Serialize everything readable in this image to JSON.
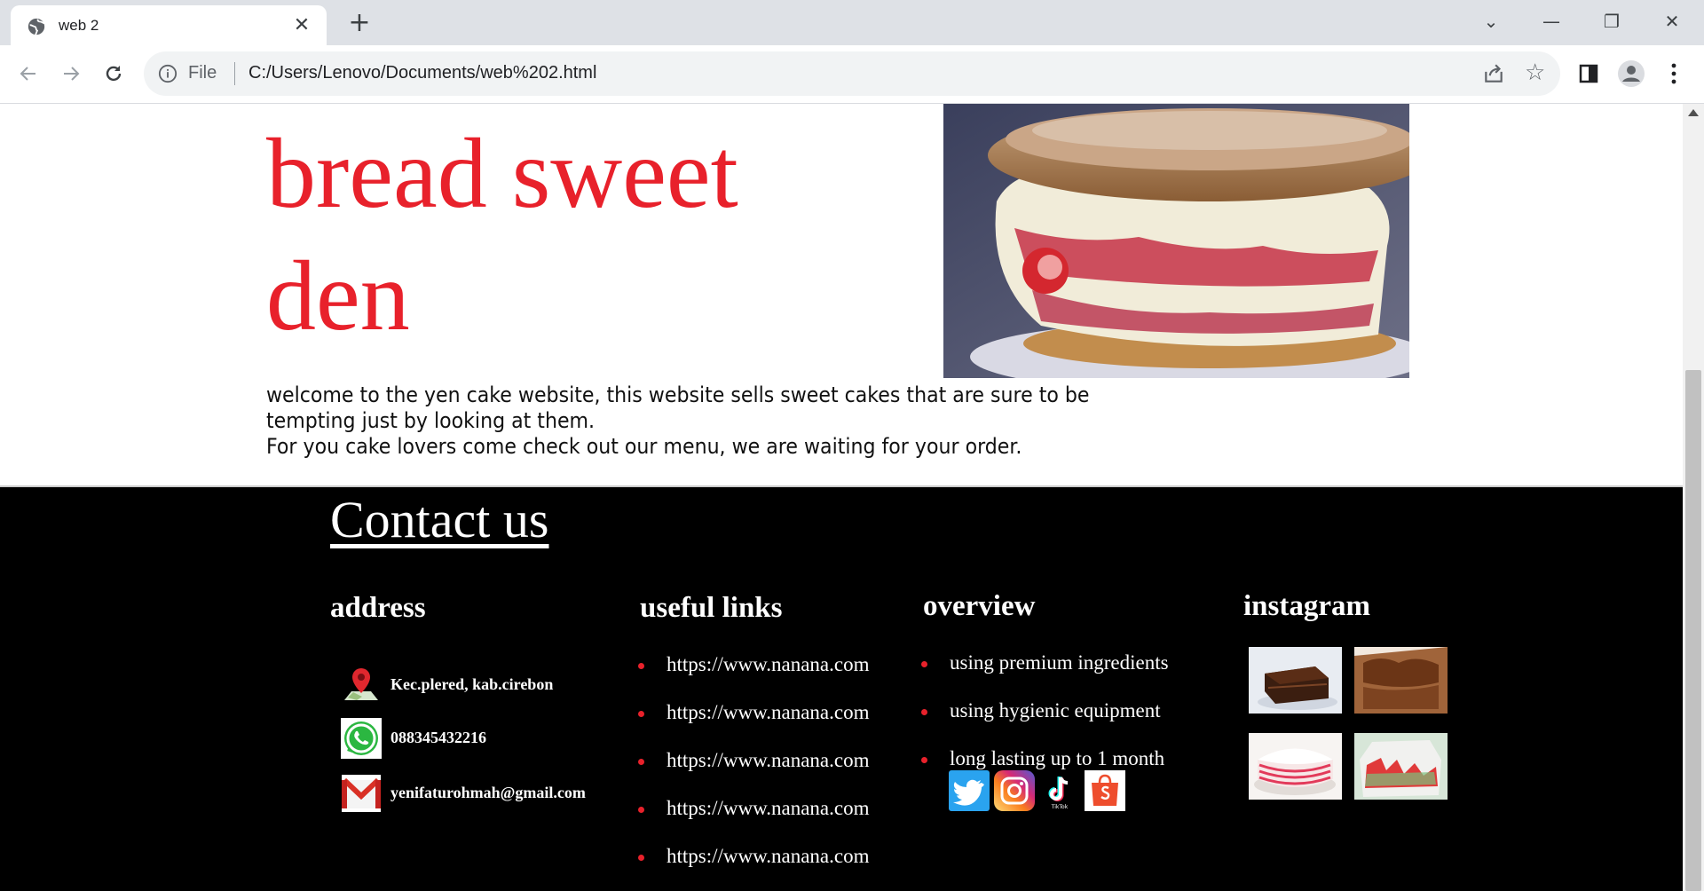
{
  "browser": {
    "tab_title": "web 2",
    "tab_close": "✕",
    "new_tab": "+",
    "scheme": "File",
    "url": "C:/Users/Lenovo/Documents/web%202.html",
    "window_controls": [
      "⌄",
      "—",
      "❐",
      "✕"
    ],
    "icons": [
      "globe-icon",
      "info-icon",
      "share-icon",
      "star-icon",
      "sidepanel-icon",
      "profile-icon",
      "menu-icon"
    ]
  },
  "hero": {
    "title": "bread sweet den",
    "welcome_line1": "welcome to the yen cake website, this website sells sweet cakes that are sure to be tempting just by looking at them.",
    "welcome_line2": "For you cake lovers come check out our menu, we are waiting for your order."
  },
  "footer": {
    "contact_title": "Contact us",
    "address": {
      "heading": "address",
      "location": "Kec.plered, kab.cirebon",
      "phone": "088345432216",
      "email": "yenifaturohmah@gmail.com"
    },
    "useful_links": {
      "heading": "useful links",
      "items": [
        "https://www.nanana.com",
        "https://www.nanana.com",
        "https://www.nanana.com",
        "https://www.nanana.com",
        "https://www.nanana.com"
      ]
    },
    "overview": {
      "heading": "overview",
      "items": [
        "using premium ingredients",
        "using hygienic equipment",
        "long lasting up to 1 month"
      ],
      "social_icons": [
        "twitter-icon",
        "instagram-icon",
        "tiktok-icon",
        "shopee-icon"
      ],
      "tiktok_caption": "TikTok"
    },
    "instagram": {
      "heading": "instagram"
    }
  },
  "colors": {
    "accent_red": "#e8212b",
    "footer_bg": "#000000"
  }
}
